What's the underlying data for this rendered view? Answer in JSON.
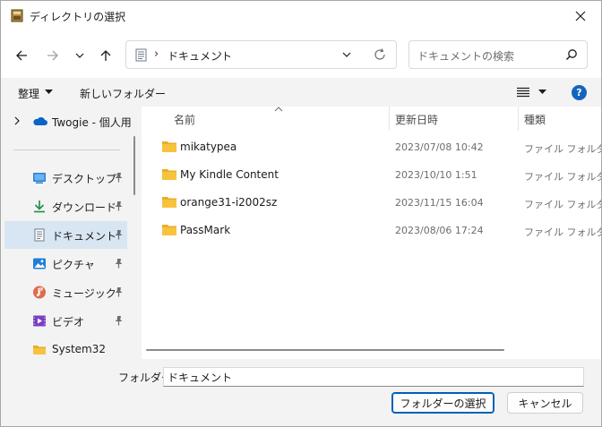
{
  "window": {
    "title": "ディレクトリの選択"
  },
  "address": {
    "current": "ドキュメント"
  },
  "search": {
    "placeholder": "ドキュメントの検索"
  },
  "toolbar": {
    "organize_label": "整理",
    "new_folder_label": "新しいフォルダー"
  },
  "sidebar": {
    "root_label": "Twogie - 個人用",
    "items": [
      {
        "label": "デスクトップ",
        "icon": "desktop-icon",
        "pinned": true
      },
      {
        "label": "ダウンロード",
        "icon": "download-icon",
        "pinned": true
      },
      {
        "label": "ドキュメント",
        "icon": "document-icon",
        "pinned": true,
        "selected": true
      },
      {
        "label": "ピクチャ",
        "icon": "picture-icon",
        "pinned": true
      },
      {
        "label": "ミュージック",
        "icon": "music-icon",
        "pinned": true
      },
      {
        "label": "ビデオ",
        "icon": "video-icon",
        "pinned": true
      },
      {
        "label": "System32",
        "icon": "folder-icon",
        "pinned": false
      }
    ]
  },
  "columns": {
    "name": "名前",
    "date": "更新日時",
    "type": "種類"
  },
  "files": [
    {
      "name": "mikatypea",
      "date": "2023/07/08 10:42",
      "type": "ファイル フォルダー"
    },
    {
      "name": "My Kindle Content",
      "date": "2023/10/10 1:51",
      "type": "ファイル フォルダー"
    },
    {
      "name": "orange31-i2002sz",
      "date": "2023/11/15 16:04",
      "type": "ファイル フォルダー"
    },
    {
      "name": "PassMark",
      "date": "2023/08/06 17:24",
      "type": "ファイル フォルダー"
    }
  ],
  "footer": {
    "folder_label": "フォルダー:",
    "folder_value": "ドキュメント",
    "select_button": "フォルダーの選択",
    "cancel_button": "キャンセル"
  },
  "colors": {
    "accent": "#005fb8",
    "selection": "#d8e6f3",
    "folder": "#f8c33c"
  }
}
